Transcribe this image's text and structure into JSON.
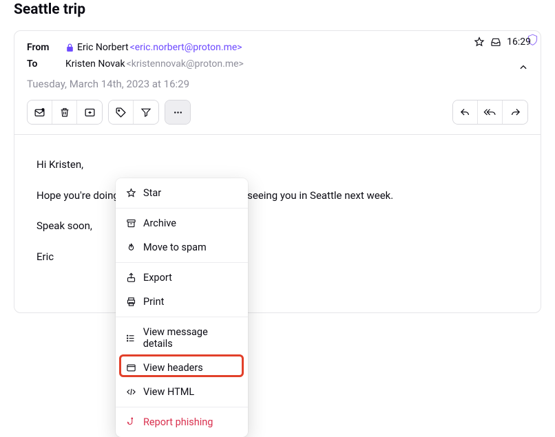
{
  "subject": "Seattle trip",
  "header": {
    "from_label": "From",
    "to_label": "To",
    "sender_name": "Eric Norbert",
    "sender_email": "<eric.norbert@proton.me>",
    "recipient_name": "Kristen Novak",
    "recipient_email": "<kristennovak@proton.me>",
    "date_line": "Tuesday, March 14th, 2023 at 16:29",
    "time": "16:29"
  },
  "body": {
    "p1": "Hi Kristen,",
    "p2": "Hope you're doing well. I'm looking forward to seeing you in Seattle next week.",
    "p3": "Speak soon,",
    "p4": "Eric"
  },
  "menu": {
    "star": "Star",
    "archive": "Archive",
    "spam": "Move to spam",
    "export": "Export",
    "print": "Print",
    "details": "View message details",
    "headers": "View headers",
    "html": "View HTML",
    "phishing": "Report phishing"
  }
}
